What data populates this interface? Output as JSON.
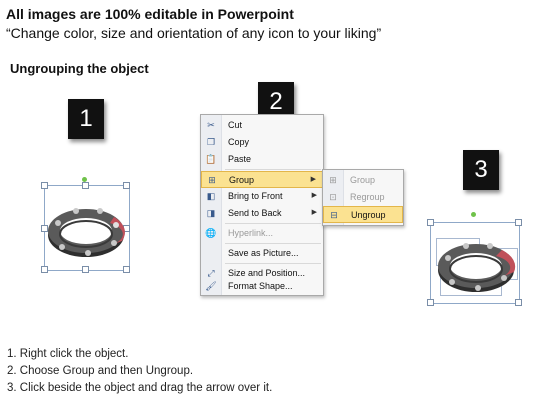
{
  "header": {
    "title": "All images are 100% editable in Powerpoint",
    "subtitle": "“Change color, size and orientation of any icon to your liking”"
  },
  "section_title": "Ungrouping the object",
  "step_boxes": [
    "1",
    "2",
    "3"
  ],
  "context_menu": {
    "items": [
      {
        "label": "Cut",
        "icon": "scissors-icon"
      },
      {
        "label": "Copy",
        "icon": "copy-icon"
      },
      {
        "label": "Paste",
        "icon": "paste-icon"
      },
      {
        "label": "Group",
        "icon": "group-icon",
        "highlighted": true,
        "submenu": true
      },
      {
        "label": "Bring to Front",
        "icon": "bring-front-icon",
        "submenu": true
      },
      {
        "label": "Send to Back",
        "icon": "send-back-icon",
        "submenu": true
      },
      {
        "label": "Hyperlink...",
        "icon": "hyperlink-icon",
        "disabled": true
      },
      {
        "label": "Save as Picture...",
        "icon": ""
      },
      {
        "label": "Size and Position...",
        "icon": "size-position-icon"
      },
      {
        "label": "Format Shape...",
        "icon": "format-shape-icon"
      }
    ]
  },
  "submenu": {
    "items": [
      {
        "label": "Group",
        "disabled": true
      },
      {
        "label": "Regroup",
        "disabled": true
      },
      {
        "label": "Ungroup",
        "highlighted": true
      }
    ]
  },
  "instructions": [
    "1.  Right click the object.",
    "2.  Choose Group and then Ungroup.",
    "3.  Click beside the object and drag the arrow over it."
  ],
  "colors": {
    "ring_dark": "#3a3a3a",
    "ring_accent": "#c0505a",
    "menu_highlight": "#fbe291"
  }
}
